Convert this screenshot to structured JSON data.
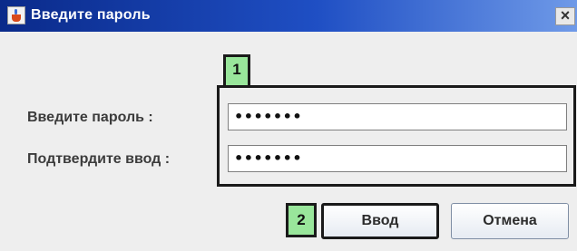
{
  "window": {
    "title": "Введите пароль",
    "close_glyph": "×"
  },
  "form": {
    "password_label": "Введите пароль :",
    "password_value": "•••••••",
    "confirm_label": "Подтвердите ввод :",
    "confirm_value": "•••••••"
  },
  "buttons": {
    "ok_label": "Ввод",
    "cancel_label": "Отмена"
  },
  "markers": {
    "fields": "1",
    "ok": "2"
  },
  "colors": {
    "marker": "#99e69b",
    "titlebar": "#1f4fc4"
  },
  "icons": {
    "app": "java-cup-icon",
    "close": "close-icon"
  }
}
